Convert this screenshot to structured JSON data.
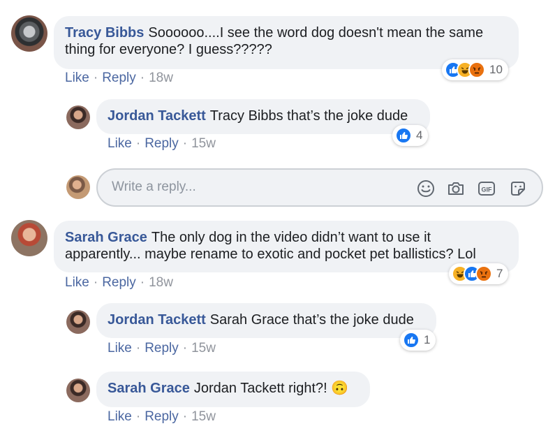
{
  "comments": [
    {
      "author": "Tracy Bibbs",
      "text": "Soooooo....I see the word dog doesn't mean the same thing for everyone? I guess?????",
      "like": "Like",
      "reply": "Reply",
      "time": "18w",
      "reaction_count": "10",
      "reactions": [
        "like",
        "haha",
        "angry"
      ]
    },
    {
      "author": "Jordan Tackett",
      "text": "Tracy Bibbs that’s the joke dude",
      "like": "Like",
      "reply": "Reply",
      "time": "15w",
      "reaction_count": "4",
      "reactions": [
        "like"
      ]
    },
    {
      "author": "Sarah Grace",
      "text": "The only dog in the video didn’t want to use it apparently... maybe rename to exotic and pocket pet ballistics? Lol",
      "like": "Like",
      "reply": "Reply",
      "time": "18w",
      "reaction_count": "7",
      "reactions": [
        "haha",
        "like",
        "angry"
      ]
    },
    {
      "author": "Jordan Tackett",
      "text": "Sarah Grace that’s the joke dude",
      "like": "Like",
      "reply": "Reply",
      "time": "15w",
      "reaction_count": "1",
      "reactions": [
        "like"
      ]
    },
    {
      "author": "Sarah Grace",
      "text": "Jordan Tackett right?! 🙃",
      "like": "Like",
      "reply": "Reply",
      "time": "15w"
    }
  ],
  "reply_box": {
    "placeholder": "Write a reply...",
    "tools": [
      "emoji-icon",
      "camera-icon",
      "gif-icon",
      "sticker-icon"
    ]
  },
  "colors": {
    "link": "#385898",
    "like_blue": "#1877f2",
    "bubble_bg": "#f0f2f5"
  }
}
